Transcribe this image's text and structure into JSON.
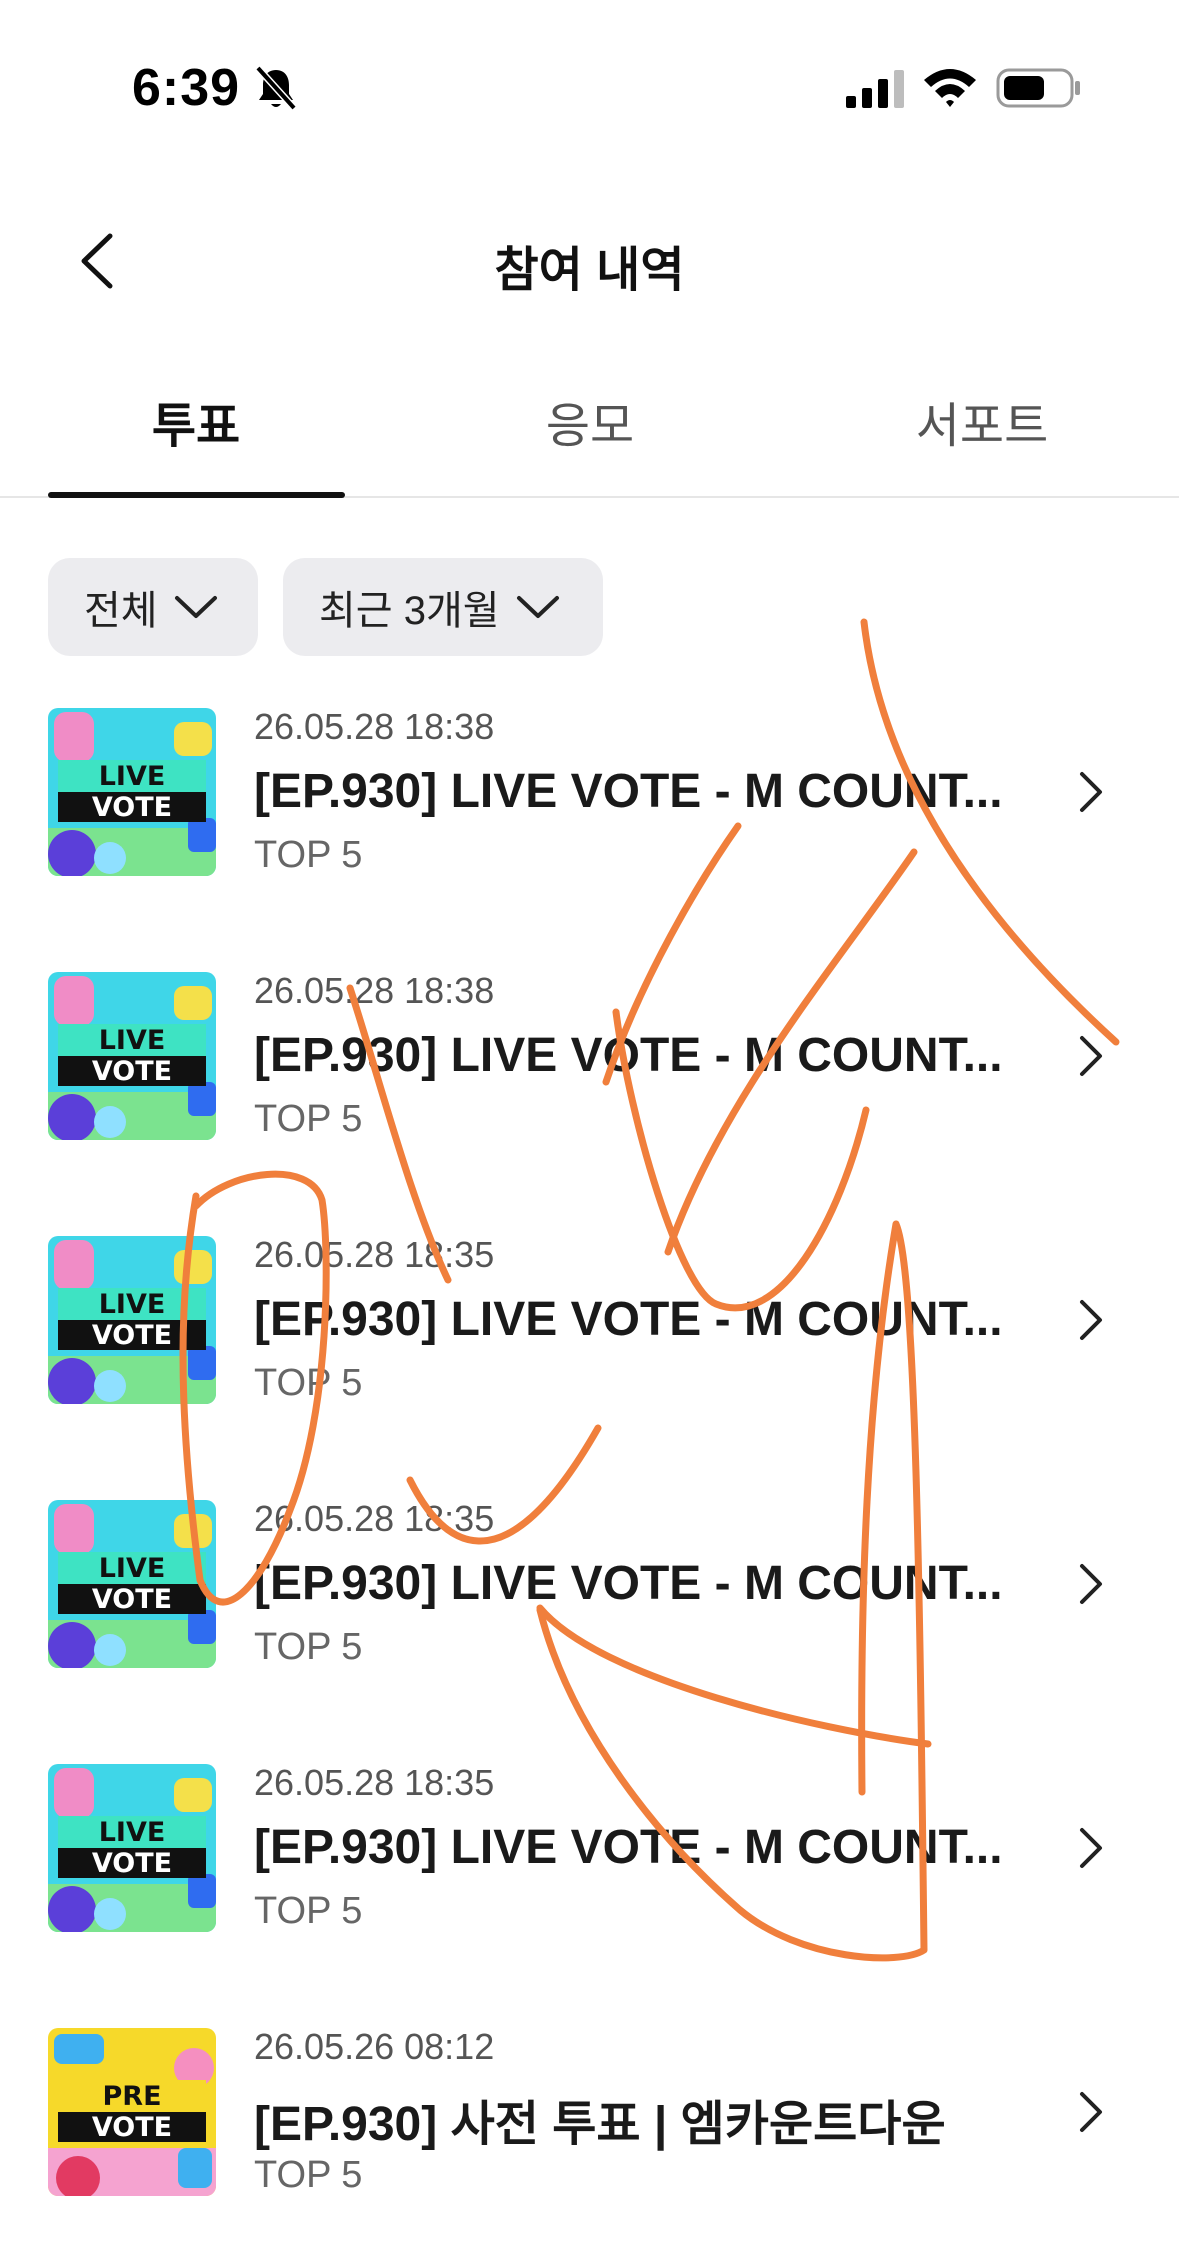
{
  "status_bar": {
    "time": "6:39",
    "icons": [
      "bell-slash-icon",
      "cellular-signal-icon",
      "wifi-icon",
      "battery-icon"
    ]
  },
  "header": {
    "title": "참여 내역",
    "back_icon": "chevron-left-icon"
  },
  "tabs": [
    {
      "label": "투표",
      "active": true
    },
    {
      "label": "응모",
      "active": false
    },
    {
      "label": "서포트",
      "active": false
    }
  ],
  "filters": [
    {
      "label": "전체"
    },
    {
      "label": "최근 3개월"
    }
  ],
  "items": [
    {
      "thumb": {
        "line1": "LIVE",
        "line2": "VOTE"
      },
      "date": "26.05.28 18:38",
      "title": "[EP.930] LIVE VOTE - M COUNT...",
      "subtitle": "TOP 5"
    },
    {
      "thumb": {
        "line1": "LIVE",
        "line2": "VOTE"
      },
      "date": "26.05.28 18:38",
      "title": "[EP.930] LIVE VOTE - M COUNT...",
      "subtitle": "TOP 5"
    },
    {
      "thumb": {
        "line1": "LIVE",
        "line2": "VOTE"
      },
      "date": "26.05.28 18:35",
      "title": "[EP.930] LIVE VOTE - M COUNT...",
      "subtitle": "TOP 5"
    },
    {
      "thumb": {
        "line1": "LIVE",
        "line2": "VOTE"
      },
      "date": "26.05.28 18:35",
      "title": "[EP.930] LIVE VOTE - M COUNT...",
      "subtitle": "TOP 5"
    },
    {
      "thumb": {
        "line1": "LIVE",
        "line2": "VOTE"
      },
      "date": "26.05.28 18:35",
      "title": "[EP.930] LIVE VOTE - M COUNT...",
      "subtitle": "TOP 5"
    },
    {
      "thumb": {
        "line1": "PRE",
        "line2": "VOTE"
      },
      "date": "26.05.26 08:12",
      "title": "[EP.930] 사전 투표 | 엠카운트다운",
      "subtitle": "TOP 5"
    }
  ],
  "colors": {
    "text_primary": "#1a1a1a",
    "text_secondary": "#666666",
    "filter_bg": "#ececef",
    "tab_indicator": "#111111",
    "scribble": "#f07f3c",
    "live_thumb_bg": "#3fd6e8",
    "pre_thumb_bg": "#f6d92a"
  }
}
